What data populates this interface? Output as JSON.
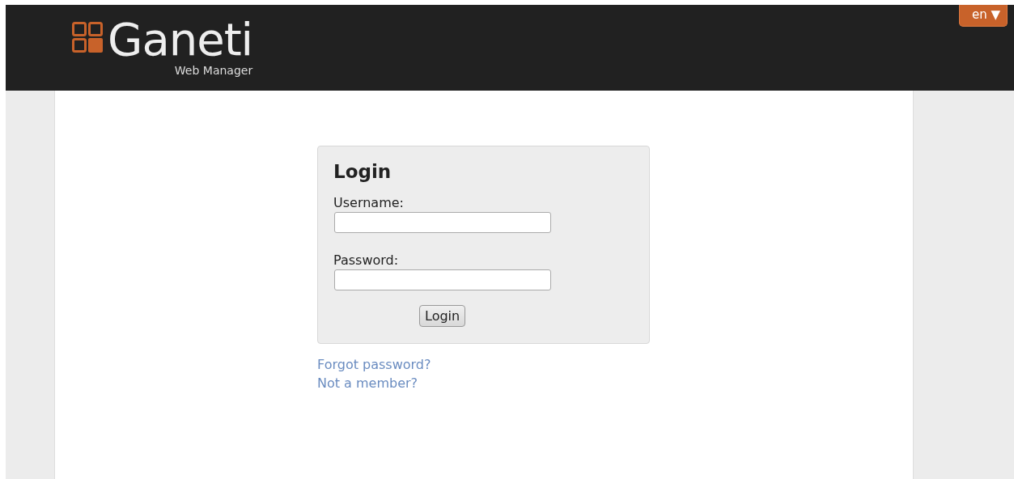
{
  "header": {
    "logo_text": "Ganeti",
    "logo_subtitle": "Web Manager",
    "language_button": {
      "label": "en",
      "caret": "▼"
    }
  },
  "login": {
    "title": "Login",
    "fields": [
      {
        "label": "Username:"
      },
      {
        "label": "Password:"
      }
    ],
    "submit": "Login"
  },
  "links": [
    "Forgot password?",
    "Not a member?"
  ]
}
